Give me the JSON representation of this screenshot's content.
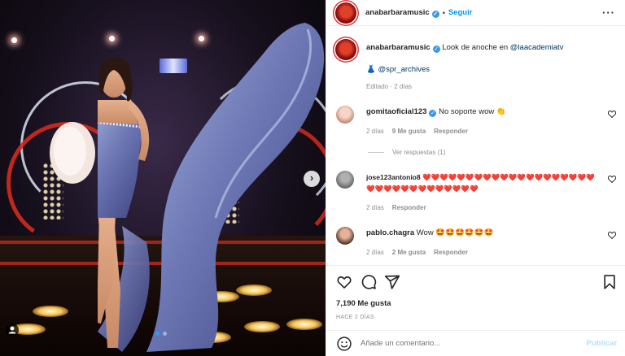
{
  "post": {
    "username": "anabarbaramusic",
    "follow_label": "Seguir",
    "separator": "•",
    "more_label": "···",
    "caption_prefix": "Look de anoche en ",
    "caption_mention": "@laacademiatv",
    "caption_line2_emoji": "👗",
    "caption_line2_mention": "@spr_archives",
    "edited": "Editado · 2 días"
  },
  "comments": [
    {
      "username": "gomitaoficial123",
      "text": "No soporte wow 👏",
      "age": "2 días",
      "likes": "9 Me gusta",
      "reply": "Responder",
      "view_replies": "Ver respuestas (1)"
    },
    {
      "username": "jose123antonio8",
      "text": "❤️❤️❤️❤️❤️❤️❤️❤️❤️❤️❤️❤️❤️❤️❤️❤️❤️❤️❤️❤️❤️❤️❤️❤️❤️❤️❤️❤️❤️❤️❤️❤️❤️",
      "age": "2 días",
      "reply": "Responder"
    },
    {
      "username": "pablo.chagra",
      "text": "Wow 🤩🤩🤩🤩🤩🤩",
      "age": "2 días",
      "likes": "2 Me gusta",
      "reply": "Responder"
    }
  ],
  "stats": {
    "likes": "7,190 Me gusta",
    "date": "HACE 2 DÍAS"
  },
  "composer": {
    "placeholder": "Añade un comentario...",
    "publish_label": "Publicar"
  },
  "carousel": {
    "current": 1,
    "total": 2
  },
  "colors": {
    "accent": "#0095f6",
    "verified": "#3897f0",
    "muted": "#8e8e8e",
    "publish_disabled": "#b2dffc"
  }
}
